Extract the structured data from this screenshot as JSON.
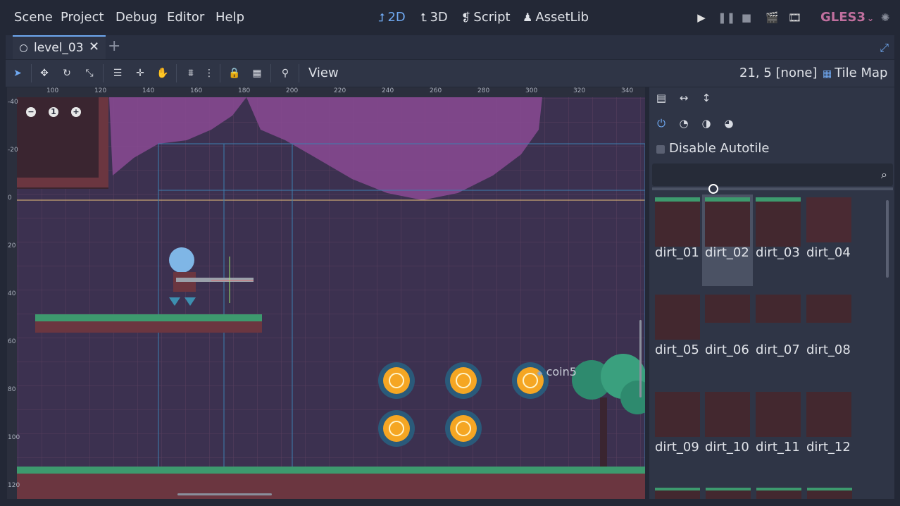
{
  "menu": [
    "Scene",
    "Project",
    "Debug",
    "Editor",
    "Help"
  ],
  "workspaces": [
    {
      "label": "2D",
      "icon": "2d-icon",
      "active": true
    },
    {
      "label": "3D",
      "icon": "3d-icon",
      "active": false
    },
    {
      "label": "Script",
      "icon": "script-icon",
      "active": false
    },
    {
      "label": "AssetLib",
      "icon": "assetlib-icon",
      "active": false
    }
  ],
  "renderer": "GLES3",
  "tab": {
    "name": "level_03"
  },
  "toolbar": {
    "view_label": "View",
    "coords": "21, 5 [none]",
    "tilemap_label": "Tile Map"
  },
  "rulers": {
    "top": [
      "100",
      "120",
      "140",
      "160",
      "180",
      "200",
      "220",
      "240",
      "260",
      "280",
      "300",
      "320",
      "340"
    ],
    "left": [
      "-40",
      "-20",
      "0",
      "20",
      "40",
      "60",
      "80",
      "100",
      "120"
    ]
  },
  "canvas": {
    "node_label": "coin5",
    "zoom_reset": "1"
  },
  "tile_panel": {
    "disable_autotile_label": "Disable Autotile",
    "search_placeholder": "",
    "tiles": [
      "dirt_01",
      "dirt_02",
      "dirt_03",
      "dirt_04",
      "dirt_05",
      "dirt_06",
      "dirt_07",
      "dirt_08",
      "dirt_09",
      "dirt_10",
      "dirt_11",
      "dirt_12"
    ],
    "selected_tile": "dirt_02"
  },
  "colors": {
    "accent": "#6fa8f0",
    "renderer": "#c06f9e",
    "background": "#232836",
    "canvas": "#3c3150",
    "grass": "#3d9a6e",
    "dirt": "#6b3640",
    "sky": "#8a4a93",
    "coin": "#f5a623"
  }
}
